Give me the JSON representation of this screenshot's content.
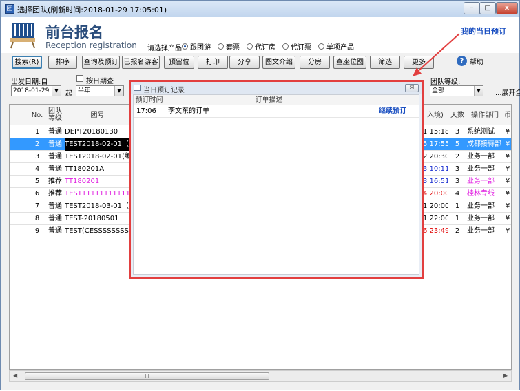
{
  "window": {
    "title": "选择团队(刷新时间:2018-01-29  17:05:01)",
    "minimize": "–",
    "maximize": "□",
    "close": "x"
  },
  "header": {
    "title_cn": "前台报名",
    "title_en": "Reception registration",
    "product_label": "请选择产品:",
    "products": [
      "跟团游",
      "套票",
      "代订房",
      "代订票",
      "单项产品"
    ],
    "today_link": "我的当日预订"
  },
  "toolbar": {
    "buttons": [
      "搜索(R)",
      "排序",
      "查询及预订",
      "已报名游客",
      "预留位",
      "打印",
      "分享",
      "图文介绍",
      "分房",
      "查座位图",
      "筛选",
      "更多"
    ],
    "help": "帮助"
  },
  "filters": {
    "depart_date_label": "出发日期:自",
    "depart_date_value": "2018-01-29",
    "from_label": "起",
    "by_date_label": "按日期查",
    "range_value": "半年",
    "team_level_label": "团队等级:",
    "team_level_value": "全部",
    "expand": "...展开全"
  },
  "grid": {
    "columns": [
      "No.",
      "团队\n等级",
      "团号",
      "入境)",
      "天数",
      "操作部门",
      "币"
    ],
    "rows": [
      {
        "no": "1",
        "level": "普通",
        "code": "DEPT20180130",
        "time": "1 15:18",
        "days": "3",
        "dept": "系统测试",
        "cur": "¥"
      },
      {
        "no": "2",
        "level": "普通",
        "code": "TEST2018-02-01（测试",
        "time": "5 17:55",
        "days": "5",
        "dept": "成都接待部",
        "cur": "¥"
      },
      {
        "no": "3",
        "level": "普通",
        "code": "TEST2018-02-01(编团",
        "time": "2 20:30",
        "days": "2",
        "dept": "业务一部",
        "cur": "¥"
      },
      {
        "no": "4",
        "level": "普通",
        "code": "TT180201A",
        "time": "3 10:11",
        "days": "3",
        "dept": "业务一部",
        "cur": "¥"
      },
      {
        "no": "5",
        "level": "推荐",
        "code": "TT180201",
        "time": "3 16:51",
        "days": "3",
        "dept": "业务一部",
        "cur": "¥"
      },
      {
        "no": "6",
        "level": "推荐",
        "code": "TEST1111111111111111",
        "time": "4 20:00",
        "days": "4",
        "dept": "桂林专线",
        "cur": "¥"
      },
      {
        "no": "7",
        "level": "普通",
        "code": "TEST2018-03-01（测试",
        "time": "1 20:00",
        "days": "1",
        "dept": "业务一部",
        "cur": "¥"
      },
      {
        "no": "8",
        "level": "普通",
        "code": "TEST-20180501",
        "time": "1 22:00",
        "days": "1",
        "dept": "业务一部",
        "cur": "¥"
      },
      {
        "no": "9",
        "level": "普通",
        "code": "TEST(CESSSSSSSSSSS",
        "time": "6 23:49",
        "days": "2",
        "dept": "业务一部",
        "cur": "¥"
      }
    ],
    "colors": {
      "selected_bg": "#3399ff",
      "magenta": "#e020e0",
      "blue": "#1a2fd0",
      "red": "#e00000"
    },
    "scroll_thumb": "III"
  },
  "dialog": {
    "title": "当日预订记录",
    "close": "☒",
    "col_time": "预订时间",
    "col_desc": "订单描述",
    "row_time": "17:06",
    "row_desc": "李文东的订单",
    "row_action": "继续预订"
  }
}
